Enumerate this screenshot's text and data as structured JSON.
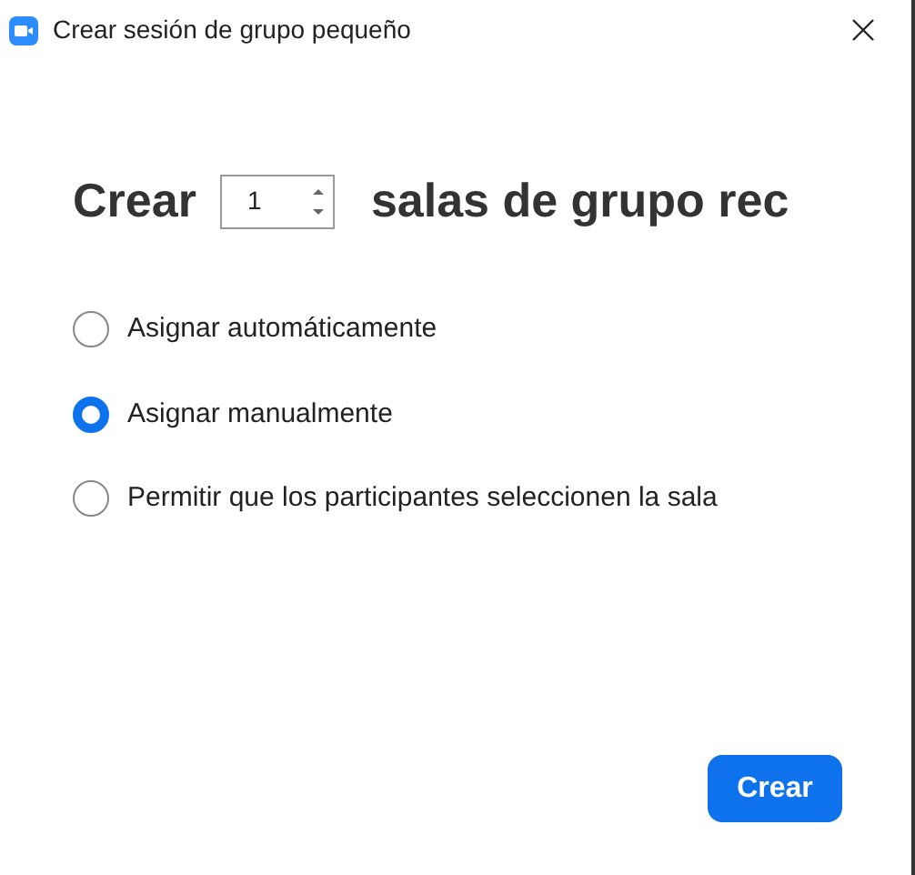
{
  "window": {
    "title": "Crear sesión de grupo pequeño"
  },
  "heading": {
    "before": "Crear",
    "count": "1",
    "after": "salas de grupo rec"
  },
  "options": [
    {
      "label": "Asignar automáticamente",
      "selected": false
    },
    {
      "label": "Asignar manualmente",
      "selected": true
    },
    {
      "label": "Permitir que los participantes seleccionen la sala",
      "selected": false
    }
  ],
  "button": "Crear"
}
